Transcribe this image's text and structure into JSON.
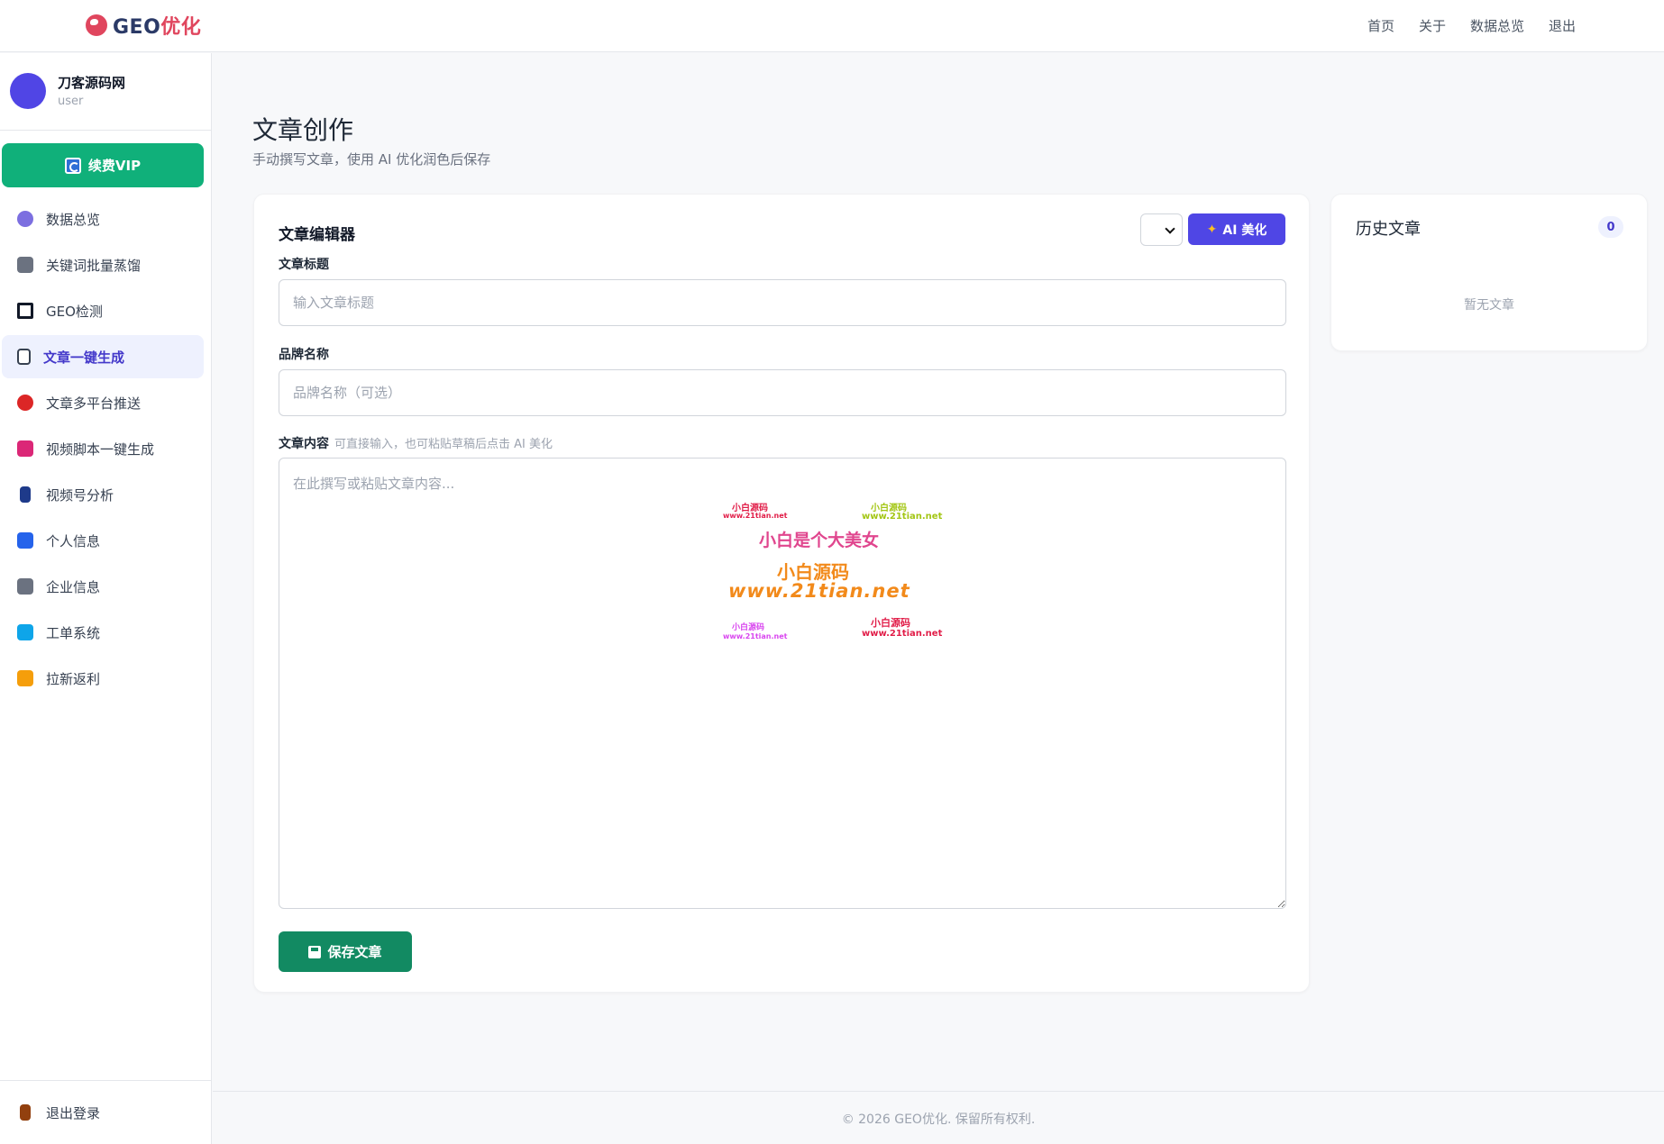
{
  "brand": {
    "name_main": "GEO",
    "name_accent": "优化"
  },
  "topnav": [
    "首页",
    "关于",
    "数据总览",
    "退出"
  ],
  "user": {
    "name": "刀客源码网",
    "role": "user"
  },
  "vip_button": "续费VIP",
  "menu": [
    {
      "label": "数据总览",
      "icon": "brain-icon",
      "color": "#7c6fe0"
    },
    {
      "label": "关键词批量蒸馏",
      "icon": "speaker-icon",
      "color": "#6b7280"
    },
    {
      "label": "GEO检测",
      "icon": "square-icon",
      "color": "#111827"
    },
    {
      "label": "文章一键生成",
      "icon": "document-icon",
      "color": "#e0465e"
    },
    {
      "label": "文章多平台推送",
      "icon": "mouth-icon",
      "color": "#dc2626"
    },
    {
      "label": "视频脚本一键生成",
      "icon": "ribbon-icon",
      "color": "#db2777"
    },
    {
      "label": "视频号分析",
      "icon": "phone-icon",
      "color": "#2563eb"
    },
    {
      "label": "个人信息",
      "icon": "repeat-icon",
      "color": "#2563eb"
    },
    {
      "label": "企业信息",
      "icon": "factory-icon",
      "color": "#6b7280"
    },
    {
      "label": "工单系统",
      "icon": "ticket-icon",
      "color": "#0ea5e9"
    },
    {
      "label": "拉新返利",
      "icon": "gift-icon",
      "color": "#f59e0b"
    }
  ],
  "active_menu_index": 3,
  "logout": {
    "label": "退出登录",
    "icon": "door-icon"
  },
  "page": {
    "title": "文章创作",
    "subtitle": "手动撰写文章，使用 AI 优化润色后保存"
  },
  "editor": {
    "title": "文章编辑器",
    "ai_button": "AI 美化",
    "title_label": "文章标题",
    "title_placeholder": "输入文章标题",
    "brand_label": "品牌名称",
    "brand_placeholder": "品牌名称（可选）",
    "content_label": "文章内容",
    "content_hint": "可直接输入，也可粘贴草稿后点击 AI 美化",
    "content_placeholder": "在此撰写或粘贴文章内容...",
    "save_button": "保存文章"
  },
  "watermark": {
    "small_cn": "小白源码",
    "small_url": "www.21tian.net",
    "big_line": "小白是个大美女",
    "mid_cn": "小白源码",
    "mid_url": "www.21tian.net"
  },
  "history": {
    "title": "历史文章",
    "count": "0",
    "empty": "暂无文章"
  },
  "footer": "© 2026 GEO优化. 保留所有权利."
}
